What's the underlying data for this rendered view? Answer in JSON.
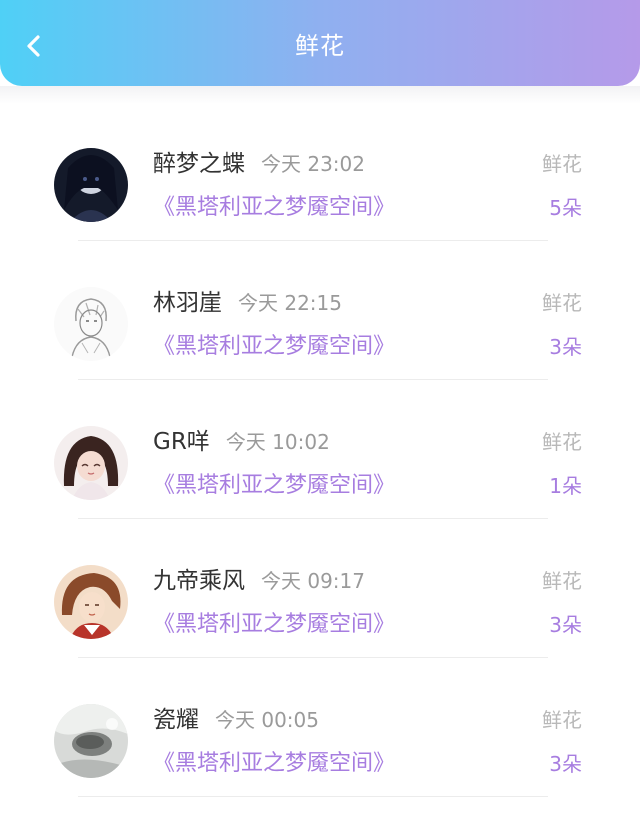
{
  "header": {
    "title": "鲜花",
    "back_icon": "chevron-left-icon"
  },
  "colors": {
    "header_gradient": [
      "#4fd0f6",
      "#b59ae9"
    ],
    "accent_purple": "#a77de0",
    "name_text": "#333333",
    "meta_text": "#9a9a9a"
  },
  "items": [
    {
      "user": "醉梦之蝶",
      "time": "今天 23:02",
      "book": "《黑塔利亚之梦魇空间》",
      "gift_label": "鲜花",
      "count": "5朵"
    },
    {
      "user": "林羽崖",
      "time": "今天 22:15",
      "book": "《黑塔利亚之梦魇空间》",
      "gift_label": "鲜花",
      "count": "3朵"
    },
    {
      "user": "GR咩",
      "time": "今天 10:02",
      "book": "《黑塔利亚之梦魇空间》",
      "gift_label": "鲜花",
      "count": "1朵"
    },
    {
      "user": "九帝乘风",
      "time": "今天 09:17",
      "book": "《黑塔利亚之梦魇空间》",
      "gift_label": "鲜花",
      "count": "3朵"
    },
    {
      "user": "瓷耀",
      "time": "今天 00:05",
      "book": "《黑塔利亚之梦魇空间》",
      "gift_label": "鲜花",
      "count": "3朵"
    }
  ]
}
